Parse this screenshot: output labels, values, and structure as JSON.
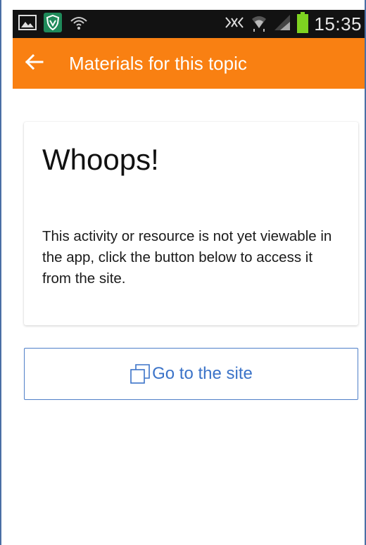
{
  "status_bar": {
    "time": "15:35",
    "left_icons": [
      "gallery-icon",
      "shield-icon",
      "wifi-hotspot-icon"
    ],
    "right_icons": [
      "nfc-icon",
      "wifi-icon",
      "signal-icon",
      "battery-icon"
    ]
  },
  "app_bar": {
    "title": "Materials for this topic",
    "back_icon": "arrow-left-icon",
    "color": "#f98012"
  },
  "card": {
    "title": "Whoops!",
    "message": "This activity or resource is not yet viewable in the app, click the button below to access it from the site."
  },
  "site_button": {
    "label": "Go to the site",
    "icon": "external-window-icon",
    "color": "#3b73c8"
  }
}
